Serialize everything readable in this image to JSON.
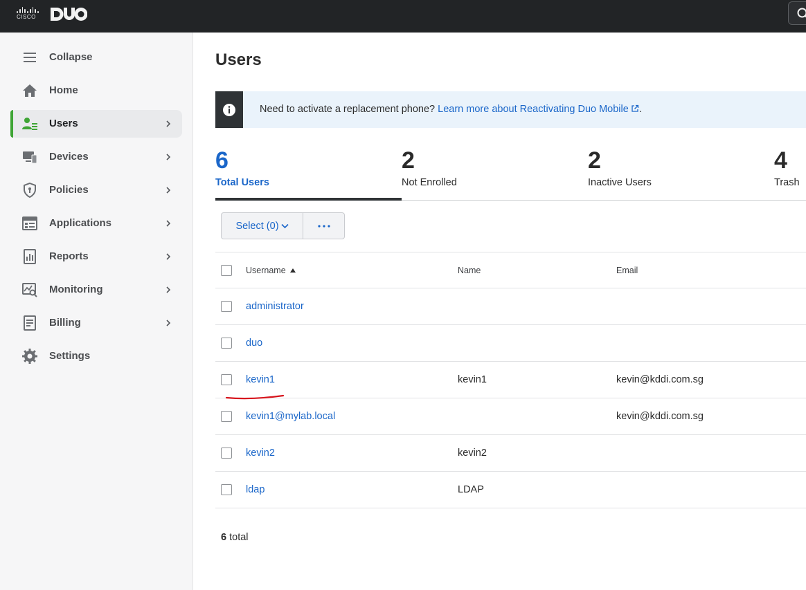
{
  "topbar": {
    "cisco_logo_text": "CISCO",
    "duo_logo_text": "DUO",
    "icons": {
      "search": "search-icon"
    }
  },
  "sidebar": {
    "items": [
      {
        "label": "Collapse",
        "icon": "menu-icon",
        "chevron": false,
        "active": false
      },
      {
        "label": "Home",
        "icon": "home-icon",
        "chevron": false,
        "active": false
      },
      {
        "label": "Users",
        "icon": "users-icon",
        "chevron": true,
        "active": true
      },
      {
        "label": "Devices",
        "icon": "devices-icon",
        "chevron": true,
        "active": false
      },
      {
        "label": "Policies",
        "icon": "shield-icon",
        "chevron": true,
        "active": false
      },
      {
        "label": "Applications",
        "icon": "applications-icon",
        "chevron": true,
        "active": false
      },
      {
        "label": "Reports",
        "icon": "reports-icon",
        "chevron": true,
        "active": false
      },
      {
        "label": "Monitoring",
        "icon": "monitoring-icon",
        "chevron": true,
        "active": false
      },
      {
        "label": "Billing",
        "icon": "billing-icon",
        "chevron": true,
        "active": false
      },
      {
        "label": "Settings",
        "icon": "gear-icon",
        "chevron": false,
        "active": false
      }
    ]
  },
  "main": {
    "title": "Users",
    "banner": {
      "text": "Need to activate a replacement phone?",
      "link": "Learn more about Reactivating Duo Mobile",
      "suffix": "."
    },
    "stats": [
      {
        "value": "6",
        "label": "Total Users",
        "active": true
      },
      {
        "value": "2",
        "label": "Not Enrolled",
        "active": false
      },
      {
        "value": "2",
        "label": "Inactive Users",
        "active": false
      },
      {
        "value": "4",
        "label": "Trash",
        "active": false
      }
    ],
    "toolbar": {
      "select_label": "Select (0)",
      "more_label": "···"
    },
    "table": {
      "columns": [
        "Username",
        "Name",
        "Email"
      ],
      "rows": [
        {
          "username": "administrator",
          "name": "",
          "email": ""
        },
        {
          "username": "duo",
          "name": "",
          "email": ""
        },
        {
          "username": "kevin1",
          "name": "kevin1",
          "email": "kevin@kddi.com.sg"
        },
        {
          "username": "kevin1@mylab.local",
          "name": "",
          "email": "kevin@kddi.com.sg"
        },
        {
          "username": "kevin2",
          "name": "kevin2",
          "email": ""
        },
        {
          "username": "ldap",
          "name": "LDAP",
          "email": ""
        }
      ]
    },
    "total": {
      "count": "6",
      "label": "total"
    }
  },
  "colors": {
    "accent_blue": "#1a66c9",
    "active_green": "#3fa535",
    "annotation_red": "#d7161e",
    "topbar": "#222426"
  }
}
